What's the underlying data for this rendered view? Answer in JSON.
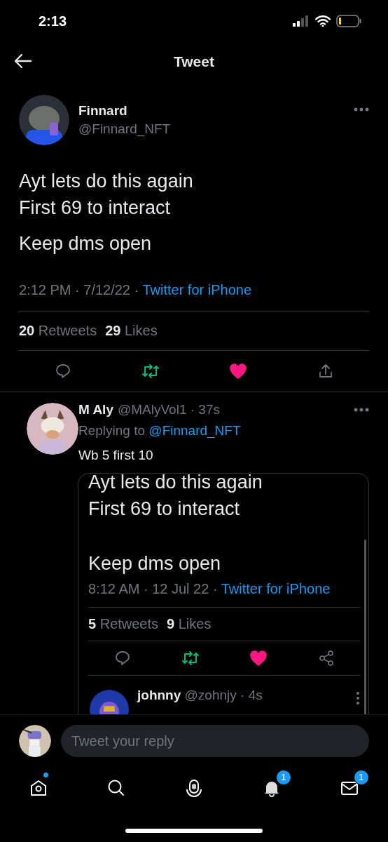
{
  "status_bar": {
    "time": "2:13"
  },
  "header": {
    "title": "Tweet"
  },
  "tweet": {
    "author": {
      "name": "Finnard",
      "handle": "@Finnard_NFT"
    },
    "paragraphs": [
      "Ayt lets do this again\nFirst 69 to interact",
      "Keep dms open"
    ],
    "timestamp": "2:12 PM · 7/12/22 · ",
    "source": "Twitter for iPhone",
    "stats": [
      "**20** Retweets",
      "**29** Likes"
    ],
    "retweeted": true,
    "liked": true
  },
  "reply": {
    "author": {
      "name": "M Aly",
      "handle": "@MAlyVol1 · 37s"
    },
    "replying_label": "Replying to",
    "replying_to": "@Finnard_NFT",
    "text": "Wb 5 first 10",
    "embedded_screenshot": {
      "paragraphs": [
        "Ayt lets do this again\nFirst 69 to interact",
        "Keep dms open"
      ],
      "timestamp": "8:12 AM · 12 Jul 22 · ",
      "source": "Twitter for iPhone",
      "stats": [
        "**5** Retweets",
        "**9** Likes"
      ],
      "retweeted": true,
      "liked": true,
      "next_reply": {
        "name": "johnny",
        "handle": "@zohnjy · 4s"
      }
    }
  },
  "reply_bar": {
    "placeholder": "Tweet your reply"
  },
  "tab_bar": [
    {
      "kind": "home",
      "dot": true
    },
    {
      "kind": "search",
      "dot": false
    },
    {
      "kind": "spaces",
      "dot": false
    },
    {
      "kind": "notifications",
      "dot": false,
      "badge": "1"
    },
    {
      "kind": "messages",
      "dot": false,
      "badge": "1"
    }
  ]
}
